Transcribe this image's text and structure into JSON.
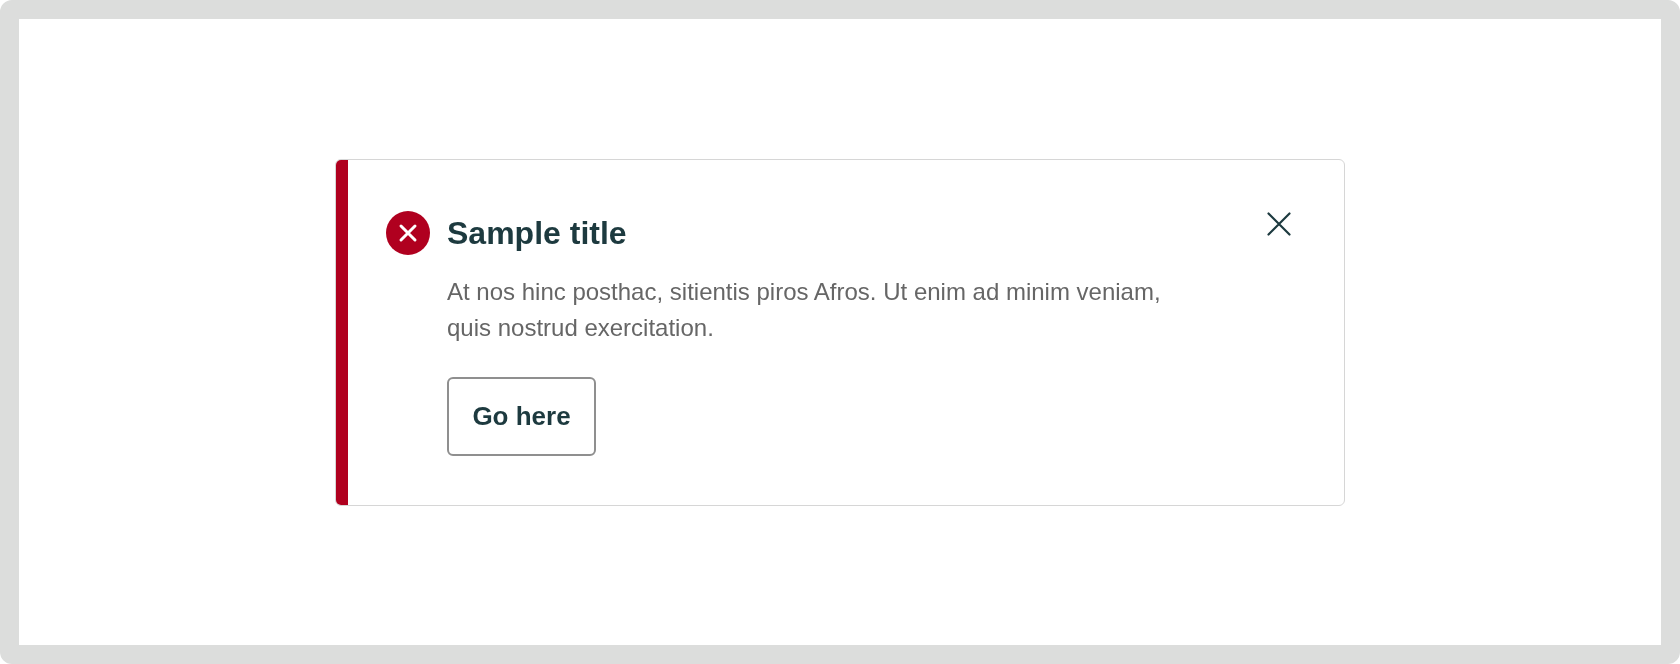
{
  "notification": {
    "kind": "error",
    "title": "Sample title",
    "message": "At nos hinc posthac, sitientis piros Afros. Ut enim ad minim veniam, quis nostrud exercitation.",
    "action": {
      "label": "Go here"
    },
    "dismissible": true
  }
}
